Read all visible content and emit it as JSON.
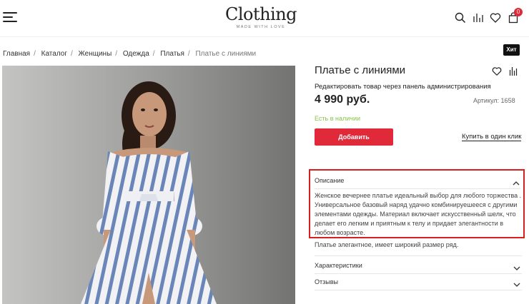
{
  "header": {
    "logo_name": "Clothing",
    "logo_tagline": "MADE WITH LOVE",
    "icons": [
      "menu-icon",
      "search-icon",
      "compare-icon",
      "heart-icon",
      "cart-icon"
    ],
    "cart_count": "0"
  },
  "breadcrumb": {
    "items": [
      "Главная",
      "Каталог",
      "Женщины",
      "Одежда",
      "Платья"
    ],
    "current": "Платье с линиями"
  },
  "badge": "Хит",
  "product": {
    "title": "Платье с линиями",
    "admin_note": "Редактировать товар через панель администрирования",
    "price": "4 990 руб.",
    "sku": "Артикул: 1658",
    "stock": "Есть в наличии",
    "add_button": "Добавить",
    "one_click": "Купить в один клик"
  },
  "description": {
    "title": "Описание",
    "text": "Женское вечернее  платье идеальный выбор для любого торжества .\nУниверсальное базовый наряд удачно комбинируешееся с другими\nэлементами одежды. Материал включает искусственный шелк, что\nделает его легким и приятным к телу и придает элегантности в\nлюбом возрасте.",
    "extra": "Платье элегантное, имеет широкий размер ряд."
  },
  "accordion": [
    "Характеристики",
    "Отзывы"
  ],
  "colors": {
    "accent": "#e02a3a",
    "stock": "#8bc34a",
    "highlight_border": "#d9201f"
  }
}
